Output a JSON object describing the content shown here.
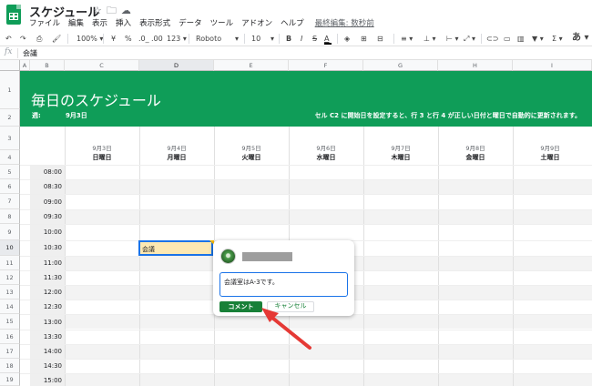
{
  "title_bar": {
    "doc_title": "スケジュール",
    "star_icon": "☆",
    "folder_icon": "🗀",
    "cloud_icon": "☁",
    "menu": [
      "ファイル",
      "編集",
      "表示",
      "挿入",
      "表示形式",
      "データ",
      "ツール",
      "アドオン",
      "ヘルプ"
    ],
    "last_edit": "最終編集: 数秒前"
  },
  "toolbar": {
    "undo": "↶",
    "redo": "↷",
    "print": "⎙",
    "paint": "🖌",
    "zoom": "100% ▾",
    "currency": "¥",
    "percent": "%",
    "decimal_less": ".0_",
    "decimal_more": ".00",
    "number_format": "123 ▾",
    "font": "Roboto",
    "font_arrow": "▾",
    "font_size": "10",
    "size_arrow": "▾",
    "bold": "B",
    "italic": "I",
    "strike": "S",
    "text_color": "A",
    "fill": "◈",
    "borders": "⊞",
    "merge": "⊟",
    "halign": "≡ ▾",
    "valign": "⊥ ▾",
    "wrap": "⊢ ▾",
    "rotate": "⤢ ▾",
    "link": "⊂⊃",
    "comment": "▭",
    "chart": "▥",
    "filter": "▼ ▾",
    "functions": "Σ ▾",
    "input_tools": "あ ▾"
  },
  "formula_bar": {
    "fx": "fx",
    "value": "会議"
  },
  "columns": [
    "A",
    "B",
    "C",
    "D",
    "E",
    "F",
    "G",
    "H",
    "I"
  ],
  "rows": [
    "1",
    "2",
    "3",
    "4",
    "5",
    "6",
    "7",
    "8",
    "9",
    "10",
    "11",
    "12",
    "13",
    "14",
    "15",
    "16",
    "17",
    "18",
    "19"
  ],
  "sheet": {
    "title": "毎日のスケジュール",
    "week_label": "週:",
    "week_value": "9月3日",
    "note": "セル C2 に開始日を設定すると、行 3 と行 4 が正しい日付と曜日で自動的に更新されます。",
    "dates": [
      "9月3日",
      "9月4日",
      "9月5日",
      "9月6日",
      "9月7日",
      "9月8日",
      "9月9日"
    ],
    "days": [
      "日曜日",
      "月曜日",
      "火曜日",
      "水曜日",
      "木曜日",
      "金曜日",
      "土曜日"
    ],
    "times": [
      "08:00",
      "08:30",
      "09:00",
      "09:30",
      "10:00",
      "10:30",
      "11:00",
      "11:30",
      "12:00",
      "12:30",
      "13:00",
      "13:30",
      "14:00",
      "14:30",
      "15:00"
    ],
    "meeting_cell": "会議"
  },
  "comment_popup": {
    "input_value": "会議室はA-3です。",
    "submit_label": "コメント",
    "cancel_label": "キャンセル"
  },
  "colors": {
    "brand_green": "#0f9d58",
    "button_green": "#188038",
    "selection_blue": "#1a73e8",
    "arrow_red": "#e53935"
  }
}
